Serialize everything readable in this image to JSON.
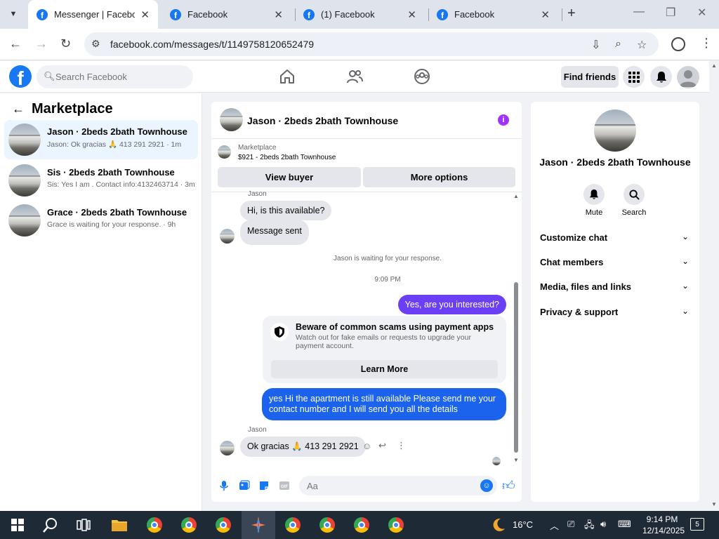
{
  "browser": {
    "tabs": [
      {
        "title": "Messenger | Facebook",
        "active": true
      },
      {
        "title": "Facebook",
        "active": false
      },
      {
        "title": "(1) Facebook",
        "active": false
      },
      {
        "title": "Facebook",
        "active": false
      }
    ],
    "url": "facebook.com/messages/t/1149758120652479"
  },
  "fb": {
    "search_placeholder": "Search Facebook",
    "find_friends": "Find friends"
  },
  "left": {
    "title": "Marketplace",
    "conversations": [
      {
        "title": "Jason · 2beds 2bath Townhouse",
        "preview": "Jason: Ok gracias 🙏 413 291 2921 · 1m",
        "selected": true
      },
      {
        "title": "Sis · 2beds 2bath Townhouse",
        "preview": "Sis: Yes I am . Contact info:4132463714 · 3m",
        "selected": false
      },
      {
        "title": "Grace · 2beds 2bath Townhouse",
        "preview": "Grace is waiting for your response. · 9h",
        "selected": false
      }
    ]
  },
  "chat": {
    "name": "Jason · 2beds 2bath Townhouse",
    "marketplace_label": "Marketplace",
    "listing": "$921 - 2beds 2bath Townhouse",
    "view_buyer": "View buyer",
    "more_options": "More options",
    "sender_name": "Jason",
    "msg_available": "Hi, is this available?",
    "msg_sent": "Message sent",
    "waiting": "Jason is waiting for your response.",
    "time": "9:09 PM",
    "out_1": "Yes, are you interested?",
    "scam_title": "Beware of common scams using payment apps",
    "scam_body": "Watch out for fake emails or requests to upgrade your payment account.",
    "learn_more": "Learn More",
    "out_2": "yes Hi the apartment is still available Please send me your contact number and I will send you all the details",
    "in_last": "Ok gracias 🙏 413 291 2921",
    "composer_placeholder": "Aa"
  },
  "right": {
    "name": "Jason · 2beds 2bath Townhouse",
    "mute": "Mute",
    "search": "Search",
    "sections": [
      "Customize chat",
      "Chat members",
      "Media, files and links",
      "Privacy & support"
    ]
  },
  "taskbar": {
    "temperature": "16°C",
    "time": "9:14 PM",
    "date": "12/14/2025",
    "notifications": "5"
  },
  "colors": {
    "fb_blue": "#1877f2",
    "outgoing_purple": "#6b3ff5",
    "outgoing_blue": "#1b63ec",
    "selected_bg": "#ebf5ff"
  }
}
